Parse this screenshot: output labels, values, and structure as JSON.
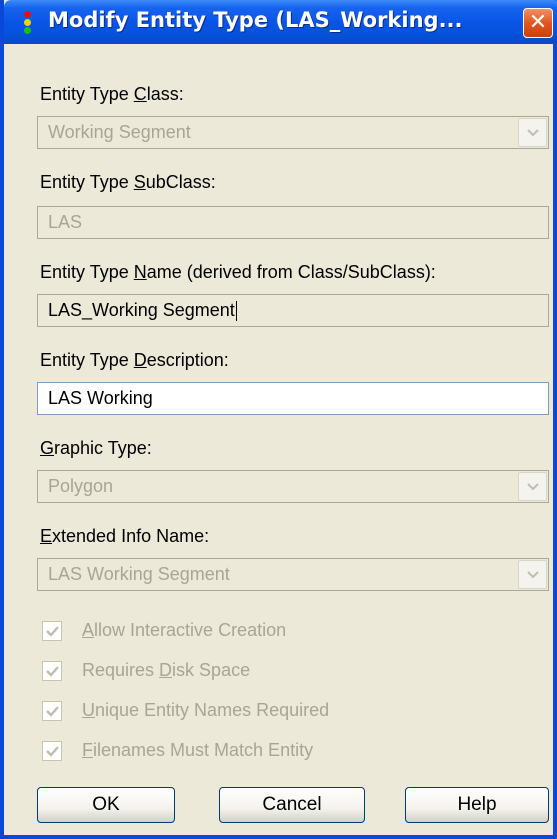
{
  "window": {
    "title": "Modify Entity Type  (LAS_Working...",
    "close_label": "✕"
  },
  "fields": {
    "class": {
      "label_pre": "Entity Type ",
      "label_key": "C",
      "label_post": "lass:",
      "value": "Working Segment"
    },
    "subclass": {
      "label_pre": "Entity Type ",
      "label_key": "S",
      "label_post": "ubClass:",
      "value": "LAS"
    },
    "name": {
      "label_pre": "Entity Type ",
      "label_key": "N",
      "label_post": "ame (derived from Class/SubClass):",
      "value": "LAS_Working Segment"
    },
    "description": {
      "label_pre": "Entity Type ",
      "label_key": "D",
      "label_post": "escription:",
      "value": "LAS Working"
    },
    "graphic_type": {
      "label_pre": "",
      "label_key": "G",
      "label_post": "raphic Type:",
      "value": "Polygon"
    },
    "extended_info": {
      "label_pre": "",
      "label_key": "E",
      "label_post": "xtended Info Name:",
      "value": "LAS Working Segment"
    }
  },
  "checkboxes": [
    {
      "label_pre": "",
      "label_key": "A",
      "label_post": "llow Interactive Creation",
      "checked": true
    },
    {
      "label_pre": "Requires ",
      "label_key": "D",
      "label_post": "isk Space",
      "checked": true
    },
    {
      "label_pre": "",
      "label_key": "U",
      "label_post": "nique Entity Names Required",
      "checked": true
    },
    {
      "label_pre": "",
      "label_key": "F",
      "label_post": "ilenames Must Match Entity",
      "checked": true
    }
  ],
  "buttons": {
    "ok": "OK",
    "cancel": "Cancel",
    "help": "Help"
  },
  "colors": {
    "titlebar": "#0a55e6",
    "dialog_bg": "#ece9d8",
    "disabled_text": "#a7a596"
  },
  "icons": {
    "app": "traffic-light-icon",
    "close": "close-icon",
    "dropdown": "chevron-down-icon",
    "check": "checkmark-icon"
  }
}
